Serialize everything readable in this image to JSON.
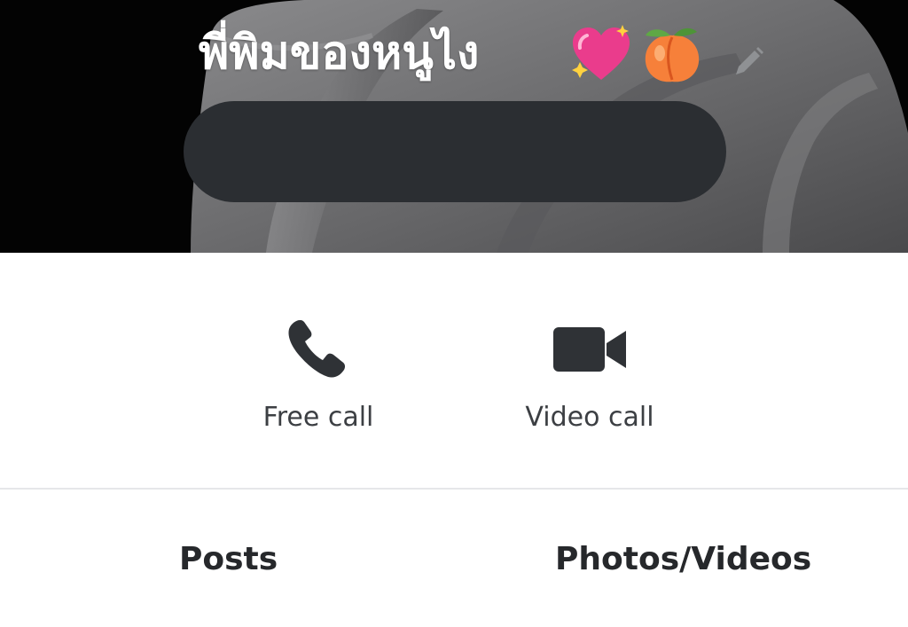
{
  "profile": {
    "name": "พี่พิมของหนูไง",
    "emojis": [
      "sparkling-heart",
      "peach"
    ],
    "status_message": ""
  },
  "actions": {
    "free_call_label": "Free call",
    "video_call_label": "Video call"
  },
  "tabs": {
    "posts_label": "Posts",
    "media_label": "Photos/Videos"
  },
  "icons": {
    "edit": "pencil-icon",
    "free_call": "phone-icon",
    "video_call": "video-camera-icon"
  },
  "colors": {
    "icon": "#2f3236",
    "label": "#3c3f43",
    "tab_text": "#26282b",
    "pill": "#2b2e32",
    "divider": "#e6e7e9"
  }
}
